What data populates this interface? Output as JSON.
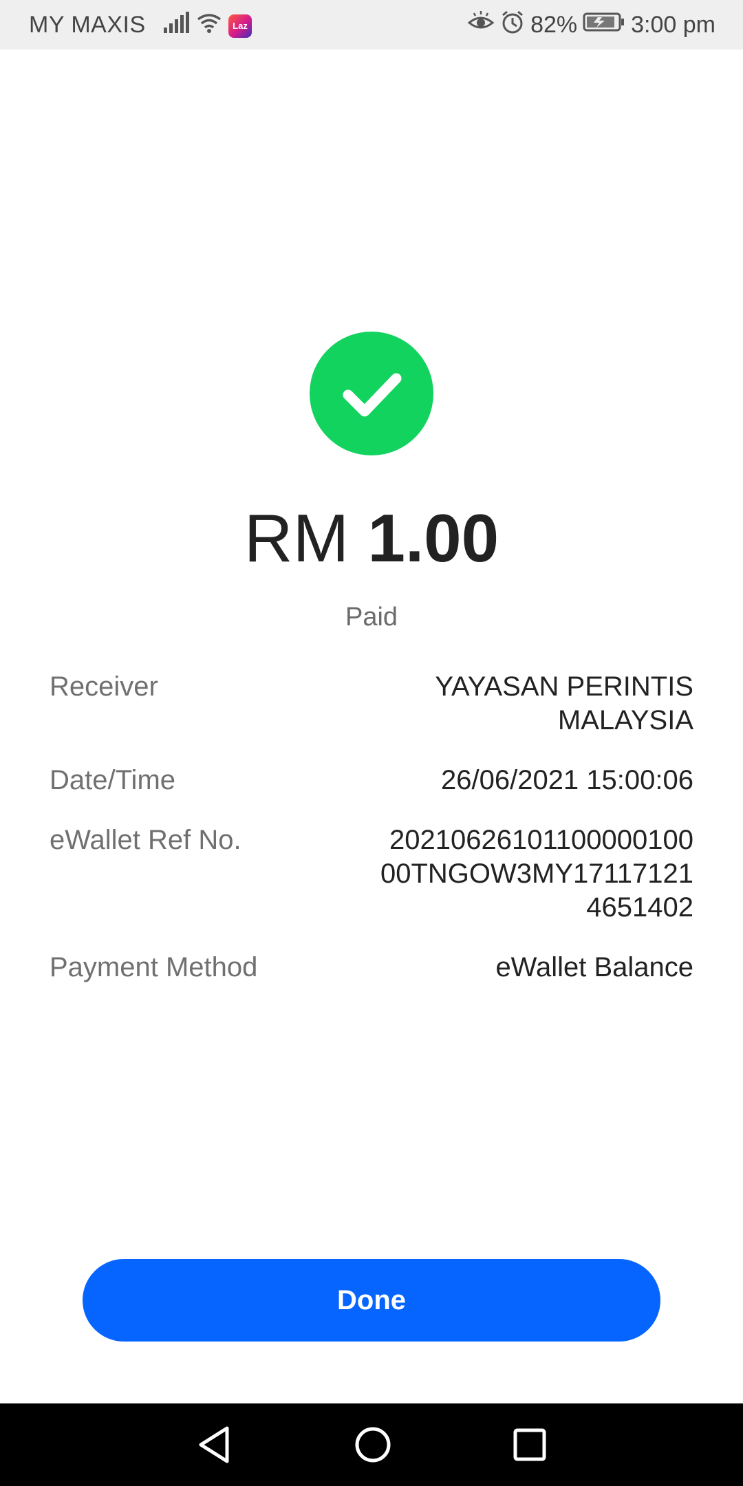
{
  "status_bar": {
    "carrier": "MY MAXIS",
    "battery_percent": "82%",
    "time": "3:00 pm",
    "icons_left": [
      "signal-icon",
      "wifi-icon",
      "lazada-app-icon"
    ],
    "icons_right": [
      "eye-comfort-icon",
      "alarm-icon",
      "battery-charging-icon"
    ],
    "laz_label": "Laz"
  },
  "payment": {
    "currency": "RM",
    "amount": "1.00",
    "status": "Paid",
    "success_color": "#12d35e"
  },
  "details": {
    "receiver_label": "Receiver",
    "receiver_value": "YAYASAN PERINTIS MALAYSIA",
    "datetime_label": "Date/Time",
    "datetime_value": "26/06/2021 15:00:06",
    "ref_label": "eWallet Ref No.",
    "ref_value": "20210626101100000100 00TNGOW3MY171171214651402",
    "method_label": "Payment Method",
    "method_value": "eWallet Balance"
  },
  "actions": {
    "done_label": "Done",
    "button_color": "#0665ff"
  },
  "nav": {
    "icons": [
      "back-icon",
      "home-icon",
      "recents-icon"
    ]
  }
}
